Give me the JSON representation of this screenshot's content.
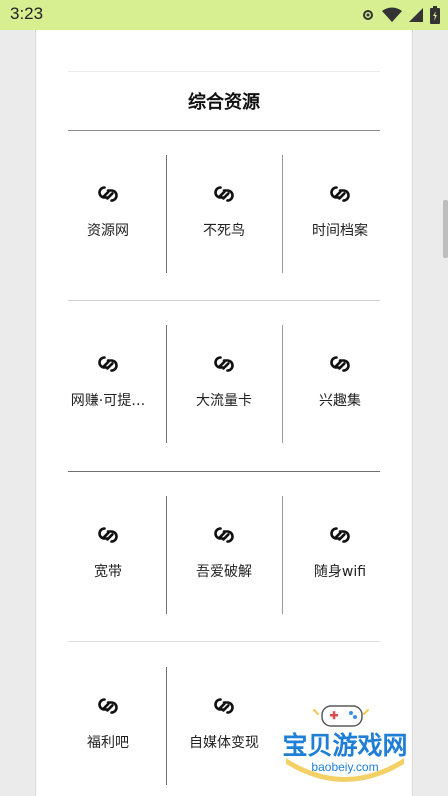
{
  "status_bar": {
    "time": "3:23"
  },
  "section": {
    "title": "综合资源"
  },
  "rows": [
    [
      "资源网",
      "不死鸟",
      "时间档案"
    ],
    [
      "网赚·可提…",
      "大流量卡",
      "兴趣集"
    ],
    [
      "宽带",
      "吾爱破解",
      "随身wifi"
    ],
    [
      "福利吧",
      "自媒体变现"
    ]
  ],
  "watermark": {
    "name": "宝贝游戏网",
    "url": "baobeiy.com"
  },
  "colors": {
    "status_bar": "#d7ee91",
    "divider": "#707070",
    "watermark_blue": "#1f7fd6"
  }
}
